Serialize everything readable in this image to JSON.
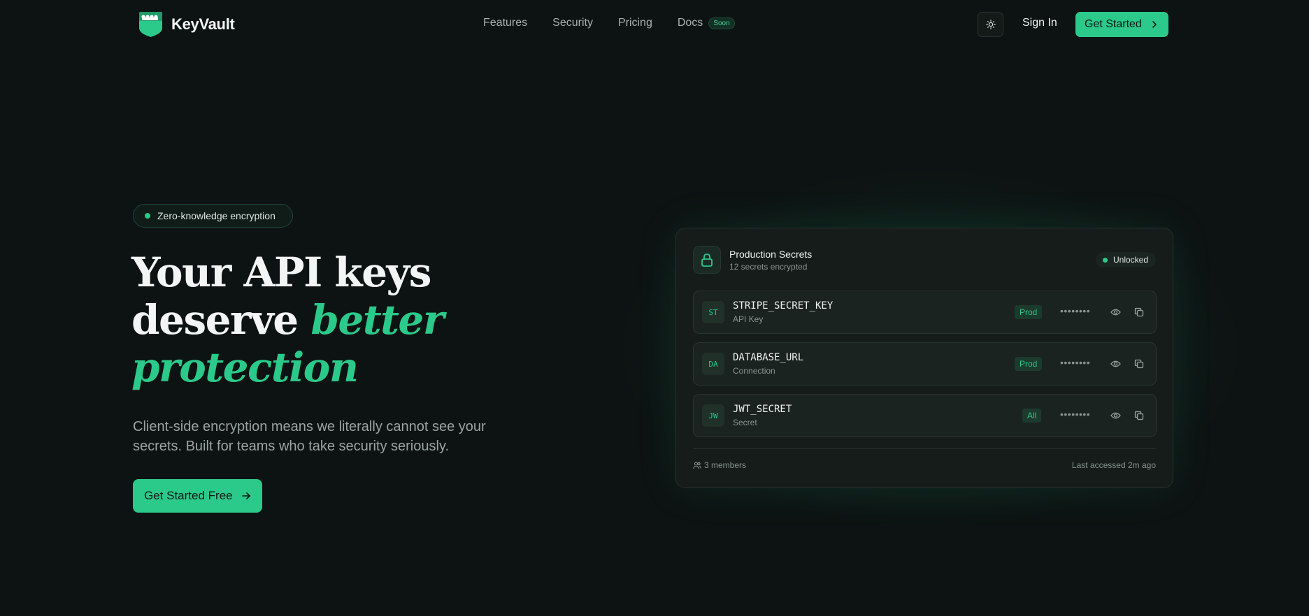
{
  "brand": {
    "name": "KeyVault"
  },
  "nav": {
    "links": [
      "Features",
      "Security",
      "Pricing",
      "Docs"
    ],
    "docs_badge": "Soon",
    "theme_icon": "sun-icon",
    "signin": "Sign In",
    "get_started": "Get Started"
  },
  "hero": {
    "pill": "Zero-knowledge encryption",
    "headline_line1": "Your API keys",
    "headline_line2_plain": "deserve ",
    "headline_line2_accent": "better",
    "headline_line3_accent": "protection",
    "subtext": "Client-side encryption means we literally cannot see your secrets. Built for teams who take security seriously.",
    "cta": "Get Started Free"
  },
  "card": {
    "title": "Production Secrets",
    "subtitle": "12 secrets encrypted",
    "status": "Unlocked",
    "secrets": [
      {
        "initials": "ST",
        "name": "STRIPE_SECRET_KEY",
        "type": "API Key",
        "env": "Prod",
        "masked": "••••••••"
      },
      {
        "initials": "DA",
        "name": "DATABASE_URL",
        "type": "Connection",
        "env": "Prod",
        "masked": "••••••••"
      },
      {
        "initials": "JW",
        "name": "JWT_SECRET",
        "type": "Secret",
        "env": "All",
        "masked": "••••••••"
      }
    ],
    "members": "3 members",
    "last_accessed": "Last accessed 2m ago"
  },
  "colors": {
    "accent": "#2bc98a",
    "background": "#0d1312",
    "card": "#151c1a"
  }
}
